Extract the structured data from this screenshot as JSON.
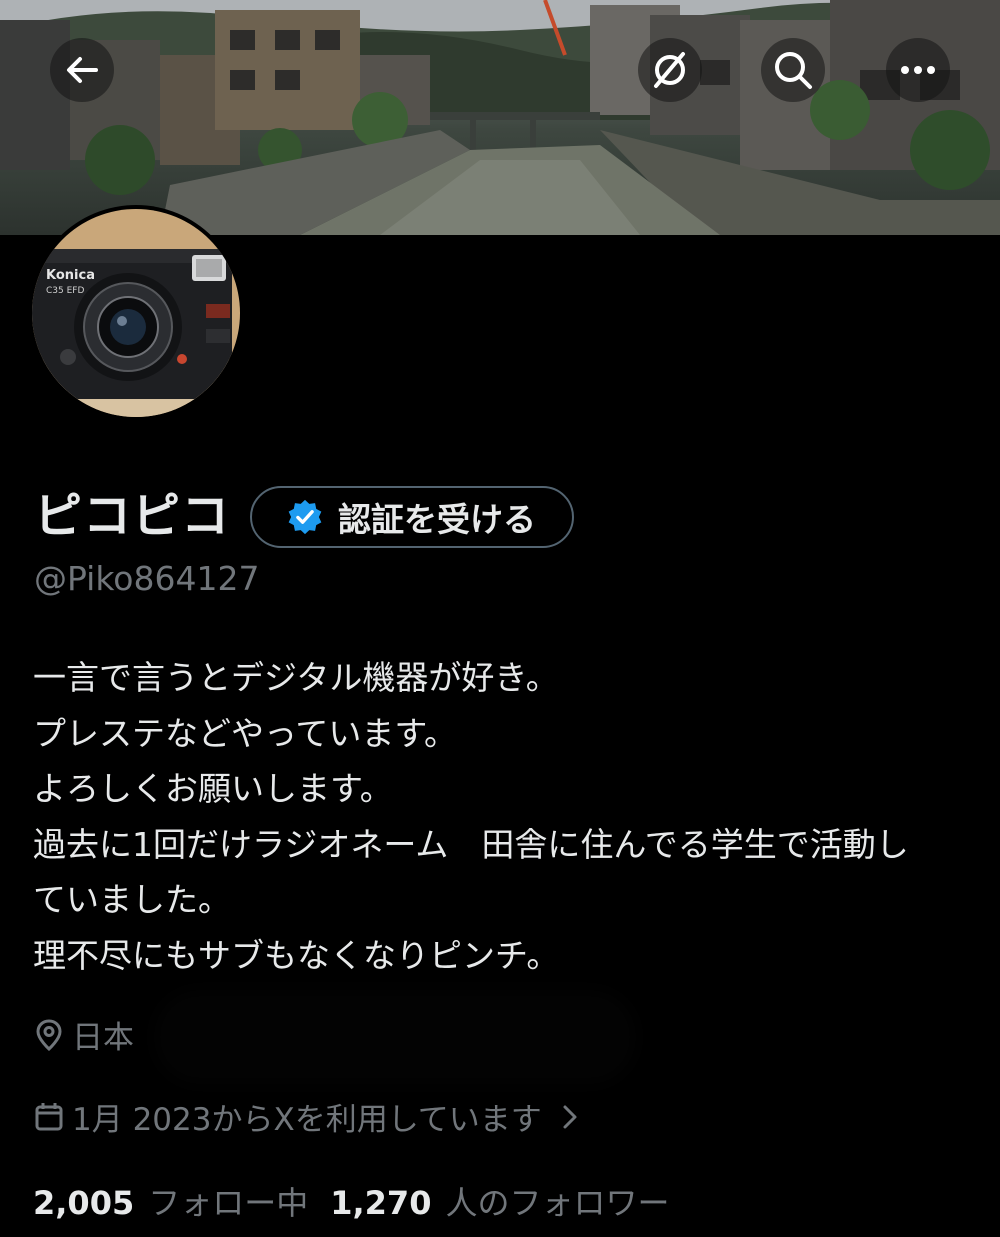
{
  "profile": {
    "display_name": "ピコピコ",
    "handle": "@Piko864127",
    "verify_button_label": "認証を受ける",
    "bio_lines": [
      "一言で言うとデジタル機器が好き。",
      "プレステなどやっています。",
      "よろしくお願いします。",
      "過去に1回だけラジオネーム　田舎に住んでる学生で活動し",
      "ていました。",
      "理不尽にもサブもなくなりピンチ。"
    ],
    "location": "日本",
    "joined": "1月 2023からXを利用しています",
    "following_count": "2,005",
    "following_label": "フォロー中",
    "followers_count": "1,270",
    "followers_label": "人のフォロワー"
  },
  "avatar": {
    "camera_brand": "Konica",
    "camera_model": "C35 EFD"
  },
  "icons": {
    "back": "arrow-left-icon",
    "grok": "grok-icon",
    "search": "search-icon",
    "more": "more-horizontal-icon",
    "verified": "verified-badge-icon",
    "location": "map-pin-icon",
    "calendar": "calendar-icon",
    "chevron": "chevron-right-icon"
  },
  "colors": {
    "background": "#000000",
    "primary_text": "#e7e9ea",
    "secondary_text": "#71767b",
    "border": "#536471",
    "verified_blue": "#1d9bf0"
  }
}
